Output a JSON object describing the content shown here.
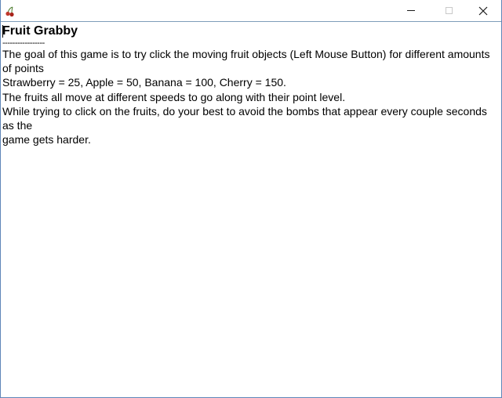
{
  "window": {
    "app_icon": "cherry-icon",
    "controls": {
      "minimize": "minimize-icon",
      "maximize": "maximize-icon",
      "close": "close-icon"
    }
  },
  "content": {
    "title": "Fruit Grabby",
    "divider": "-----------------",
    "lines": [
      "The goal of this game is to try click the moving fruit objects (Left Mouse Button) for different amounts of points",
      "Strawberry = 25, Apple = 50, Banana = 100, Cherry = 150.",
      "The fruits all move at different speeds to go along with their point level.",
      "While trying to click on the fruits, do your best to avoid the bombs that appear every couple seconds as the",
      "game gets harder."
    ]
  },
  "colors": {
    "window_border": "#5f86b8",
    "text": "#000000",
    "cherry_red": "#c0392b"
  }
}
